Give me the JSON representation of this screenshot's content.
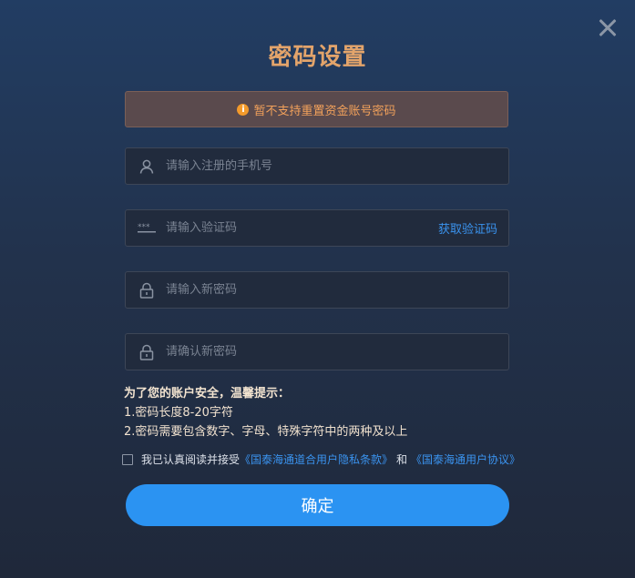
{
  "dialog": {
    "title": "密码设置",
    "notice": "暂不支持重置资金账号密码",
    "notice_icon": "info-icon"
  },
  "fields": {
    "phone": {
      "placeholder": "请输入注册的手机号",
      "icon": "user-icon"
    },
    "code": {
      "placeholder": "请输入验证码",
      "icon": "password-dots-icon",
      "action_label": "获取验证码"
    },
    "new_password": {
      "placeholder": "请输入新密码",
      "icon": "lock-icon"
    },
    "confirm_password": {
      "placeholder": "请确认新密码",
      "icon": "lock-icon"
    }
  },
  "tips": {
    "title": "为了您的账户安全，温馨提示：",
    "line1": "1.密码长度8-20字符",
    "line2": "2.密码需要包含数字、字母、特殊字符中的两种及以上"
  },
  "agreement": {
    "prefix": "我已认真阅读并接受",
    "link1": "《国泰海通道合用户隐私条款》",
    "and": "和",
    "link2": "《国泰海通用户协议》",
    "checked": false
  },
  "buttons": {
    "confirm": "确定"
  },
  "colors": {
    "title": "#e3a46b",
    "notice_text": "#f2a15b",
    "accent": "#2b93f2",
    "link": "#3a93ee"
  }
}
